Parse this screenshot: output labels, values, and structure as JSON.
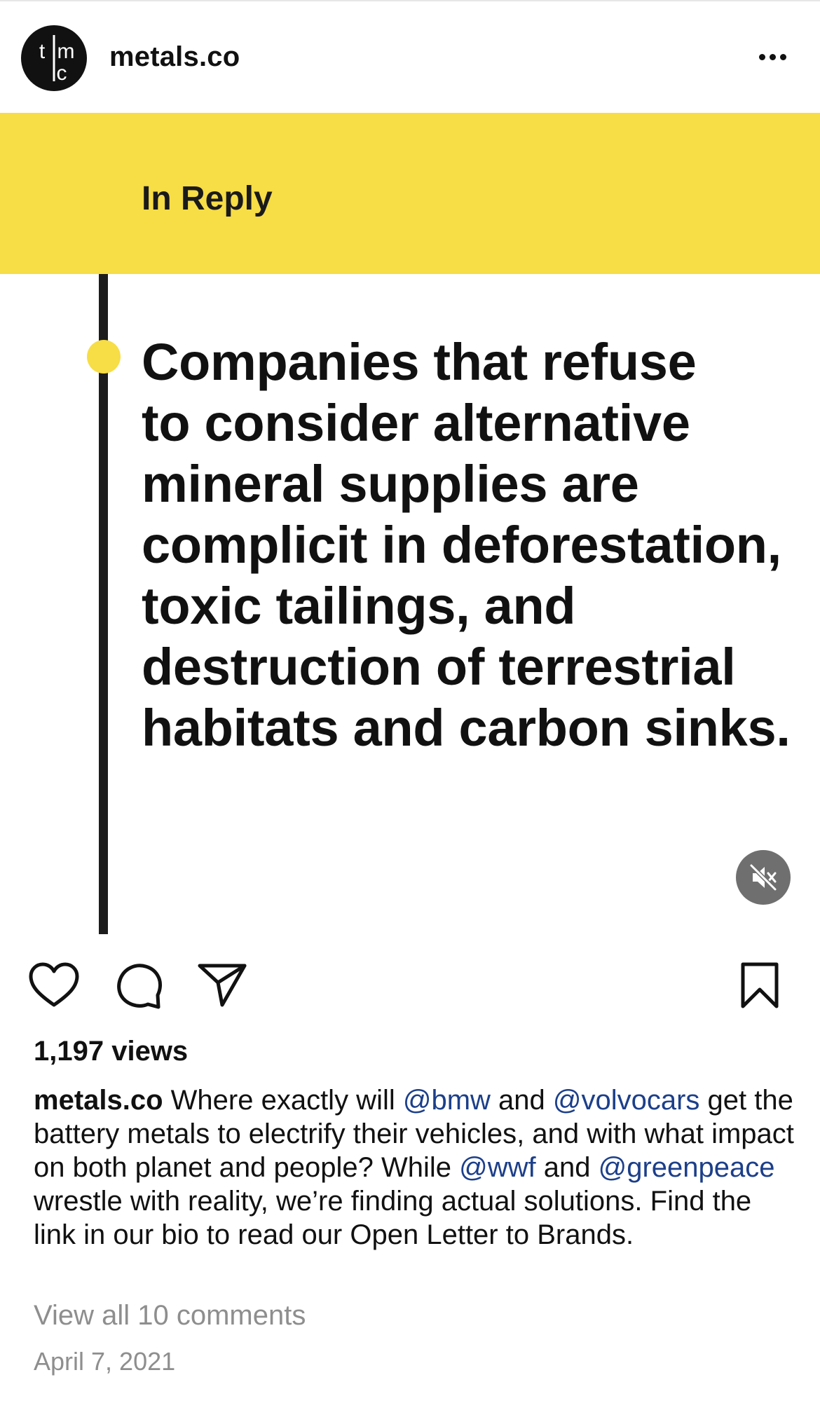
{
  "post": {
    "username": "metals.co",
    "avatar_initials": "tmc",
    "media": {
      "banner_label": "In Reply",
      "quote": "Companies that refuse to consider alternative mineral supplies are complicit in deforestation, toxic tailings, and destruction of terrestrial habitats and carbon sinks.",
      "quote_lines": [
        "Companies that refuse",
        "to consider alternative",
        "mineral supplies are",
        "complicit in deforestation,",
        "toxic tailings, and",
        "destruction of terrestrial",
        "habitats and carbon sinks."
      ],
      "muted": true,
      "banner_color": "#f7dd46",
      "line_color": "#1c1c1c"
    },
    "views": "1,197 views",
    "caption": {
      "user": "metals.co",
      "parts": [
        {
          "text": " Where exactly will ",
          "type": "text"
        },
        {
          "text": "@bmw",
          "type": "mention"
        },
        {
          "text": " and ",
          "type": "text"
        },
        {
          "text": "@volvocars",
          "type": "mention"
        },
        {
          "text": " get the battery metals to electrify their vehicles, and with what impact on both planet and people? While ",
          "type": "text"
        },
        {
          "text": "@wwf",
          "type": "mention"
        },
        {
          "text": " and ",
          "type": "text"
        },
        {
          "text": "@greenpeace",
          "type": "mention"
        },
        {
          "text": " wrestle with reality, we’re finding actual solutions. Find the link in our bio to read our Open Letter to Brands.",
          "type": "text"
        }
      ]
    },
    "view_comments": "View all 10 comments",
    "date": "April 7, 2021",
    "icons": {
      "more": "more-options-icon",
      "like": "heart-icon",
      "comment": "comment-bubble-icon",
      "share": "paper-plane-icon",
      "save": "bookmark-icon",
      "mute": "speaker-muted-icon"
    },
    "colors": {
      "mention": "#1c3f8a",
      "muted_text": "#8e8e8e"
    }
  }
}
